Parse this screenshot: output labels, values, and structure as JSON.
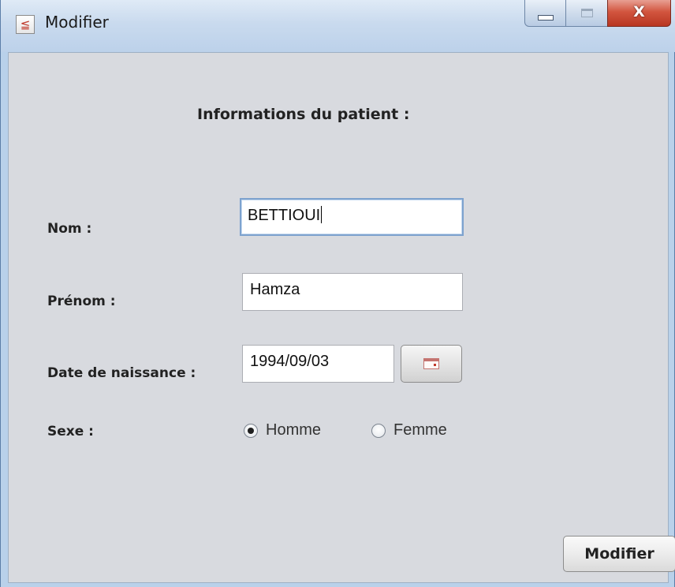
{
  "window": {
    "title": "Modifier",
    "controls": {
      "minimize_icon": "minimize-icon",
      "maximize_icon": "maximize-icon",
      "close_icon": "close-icon",
      "close_glyph": "X"
    },
    "app_icon": "java-app-icon",
    "app_icon_glyph": "≦"
  },
  "form": {
    "heading": "Informations du patient :",
    "nom": {
      "label": "Nom :",
      "value": "BETTIOUI"
    },
    "prenom": {
      "label": "Prénom :",
      "value": "Hamza"
    },
    "date_naissance": {
      "label": "Date de naissance :",
      "value": "1994/09/03",
      "calendar_icon": "calendar-icon"
    },
    "sexe": {
      "label": "Sexe :",
      "options": [
        {
          "label": "Homme",
          "selected": true
        },
        {
          "label": "Femme",
          "selected": false
        }
      ]
    },
    "submit_label": "Modifier"
  },
  "colors": {
    "content_bg": "#d8dadf",
    "titlebar": "#c9daee",
    "close_button": "#d2553f",
    "focus_border": "#7da2ce"
  }
}
